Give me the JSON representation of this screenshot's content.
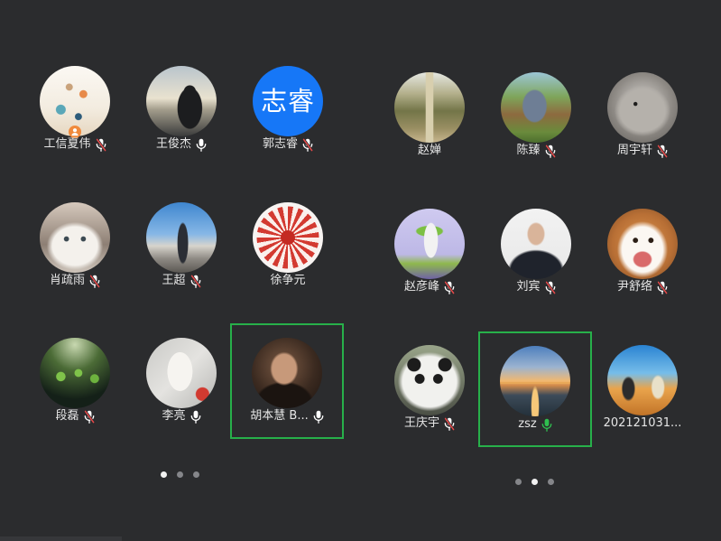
{
  "theme": {
    "background": "#2b2c2e",
    "name_text": "#e6e6e6",
    "highlight": "#27b04a",
    "mic_on": "#ffffff",
    "mic_speaking": "#2fbf4f",
    "mic_muted_slash": "#e84a4a",
    "host_badge": "#f08a3c",
    "dot_active": "#f2f2f2",
    "dot_inactive": "#85868a"
  },
  "pages": [
    {
      "participants": [
        {
          "name": "工信夏伟",
          "mic_icon": "mic-muted-icon",
          "badge_icon": "host-icon"
        },
        {
          "name": "王俊杰",
          "mic_icon": "mic-on-icon"
        },
        {
          "name": "郭志睿",
          "mic_icon": "mic-muted-icon",
          "avatar_text": "志睿",
          "avatar_color": "#1677f7"
        },
        {
          "name": "肖疏雨",
          "mic_icon": "mic-muted-icon"
        },
        {
          "name": "王超",
          "mic_icon": "mic-muted-icon"
        },
        {
          "name": "徐争元"
        },
        {
          "name": "段磊",
          "mic_icon": "mic-muted-icon"
        },
        {
          "name": "李亮",
          "mic_icon": "mic-on-icon"
        },
        {
          "name": "胡本慧 B...",
          "mic_icon": "mic-on-icon",
          "highlighted": true
        }
      ],
      "page_dots": [
        true,
        false,
        false
      ]
    },
    {
      "participants": [
        {
          "name": "赵婵"
        },
        {
          "name": "陈臻",
          "mic_icon": "mic-muted-icon"
        },
        {
          "name": "周宇轩",
          "mic_icon": "mic-muted-icon"
        },
        {
          "name": "赵彦峰",
          "mic_icon": "mic-muted-icon"
        },
        {
          "name": "刘宾",
          "mic_icon": "mic-muted-icon"
        },
        {
          "name": "尹舒络",
          "mic_icon": "mic-muted-icon"
        },
        {
          "name": "王庆宇",
          "mic_icon": "mic-muted-icon"
        },
        {
          "name": "zsz",
          "mic_icon": "mic-speaking-icon",
          "highlighted": true
        },
        {
          "name": "202121031..."
        }
      ],
      "page_dots": [
        false,
        true,
        false
      ]
    }
  ]
}
